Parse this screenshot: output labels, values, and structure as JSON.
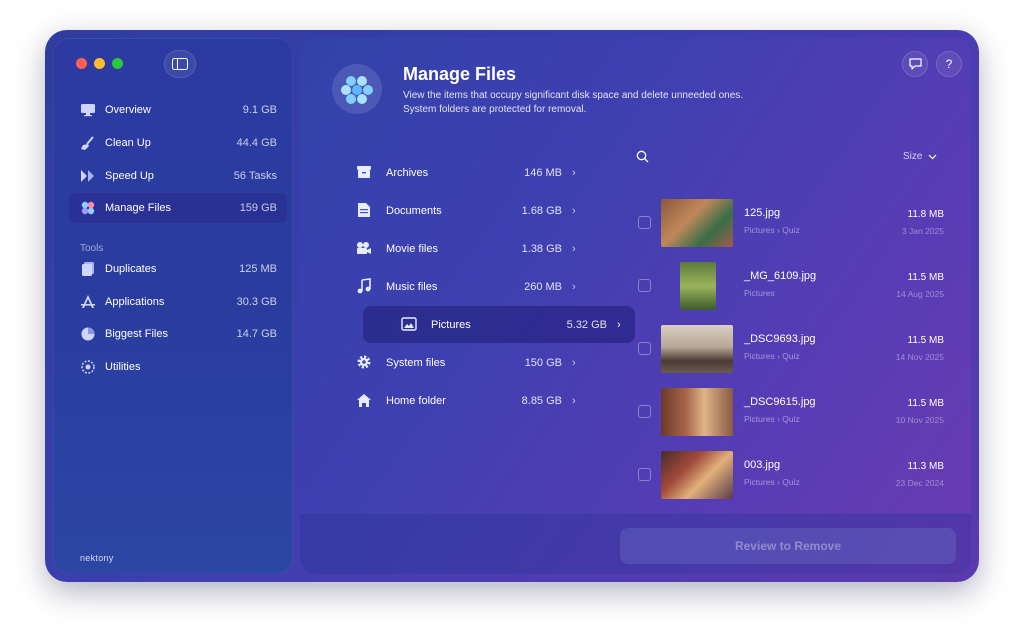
{
  "sidebar": {
    "items": [
      {
        "label": "Overview",
        "value": "9.1 GB",
        "icon": "monitor-icon"
      },
      {
        "label": "Clean Up",
        "value": "44.4 GB",
        "icon": "broom-icon"
      },
      {
        "label": "Speed Up",
        "value": "56 Tasks",
        "icon": "speed-icon"
      },
      {
        "label": "Manage Files",
        "value": "159 GB",
        "icon": "hexagons-icon",
        "active": true
      }
    ],
    "tools_title": "Tools",
    "tools": [
      {
        "label": "Duplicates",
        "value": "125 MB",
        "icon": "duplicates-icon"
      },
      {
        "label": "Applications",
        "value": "30.3 GB",
        "icon": "applications-icon"
      },
      {
        "label": "Biggest Files",
        "value": "14.7 GB",
        "icon": "pie-icon"
      },
      {
        "label": "Utilities",
        "value": "",
        "icon": "utilities-icon"
      }
    ],
    "brand": "nektony"
  },
  "header": {
    "title": "Manage Files",
    "subtitle_line1": "View the items that occupy significant disk space and delete unneeded ones.",
    "subtitle_line2": "System folders are protected for removal."
  },
  "categories": [
    {
      "label": "Archives",
      "value": "146 MB",
      "icon": "archive-icon"
    },
    {
      "label": "Documents",
      "value": "1.68 GB",
      "icon": "document-icon"
    },
    {
      "label": "Movie files",
      "value": "1.38 GB",
      "icon": "movie-icon"
    },
    {
      "label": "Music files",
      "value": "260 MB",
      "icon": "music-icon"
    },
    {
      "label": "Pictures",
      "value": "5.32 GB",
      "icon": "picture-icon",
      "active": true
    },
    {
      "label": "System files",
      "value": "150 GB",
      "icon": "gear-icon"
    },
    {
      "label": "Home folder",
      "value": "8.85 GB",
      "icon": "home-icon"
    }
  ],
  "list": {
    "sort_label": "Size",
    "files": [
      {
        "name": "125.jpg",
        "folder": "Pictures",
        "subfolder": "Quiz",
        "size": "11.8 MB",
        "date": "3 Jan 2025"
      },
      {
        "name": "_MG_6109.jpg",
        "folder": "Pictures",
        "subfolder": "",
        "size": "11.5 MB",
        "date": "14 Aug 2025"
      },
      {
        "name": "_DSC9693.jpg",
        "folder": "Pictures",
        "subfolder": "Quiz",
        "size": "11.5 MB",
        "date": "14 Nov 2025"
      },
      {
        "name": "_DSC9615.jpg",
        "folder": "Pictures",
        "subfolder": "Quiz",
        "size": "11.5 MB",
        "date": "10 Nov 2025"
      },
      {
        "name": "003.jpg",
        "folder": "Pictures",
        "subfolder": "Quiz",
        "size": "11.3 MB",
        "date": "23 Dec 2024"
      }
    ]
  },
  "review_button": "Review to Remove",
  "colors": {
    "accent": "#3a3fae",
    "active_row": "#262482"
  }
}
